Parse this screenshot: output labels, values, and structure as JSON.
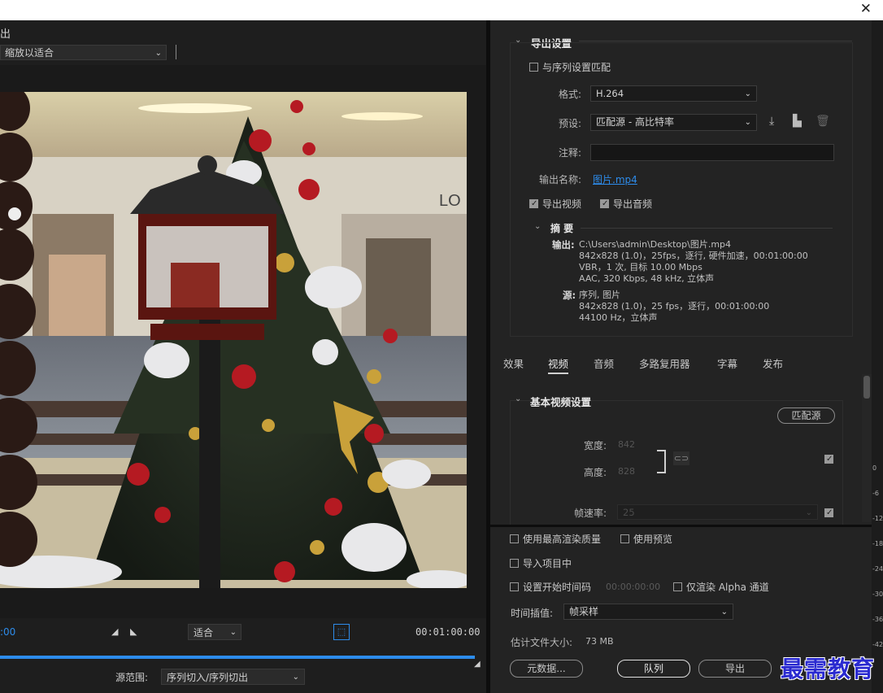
{
  "window": {
    "close_glyph": "✕"
  },
  "left_panel": {
    "tab_title": "出",
    "zoom_value": "缩放以适合",
    "timecode_start": ":00",
    "fit_value": "适合",
    "timecode_end": "00:01:00:00",
    "source_range_label": "源范围:",
    "source_range_value": "序列切入/序列切出"
  },
  "export_settings": {
    "header": "导出设置",
    "match_sequence_label": "与序列设置匹配",
    "match_sequence_checked": false,
    "format_label": "格式:",
    "format_value": "H.264",
    "preset_label": "预设:",
    "preset_value": "匹配源 - 高比特率",
    "comments_label": "注释:",
    "output_name_label": "输出名称:",
    "output_name_value": "图片.mp4",
    "export_video_label": "导出视频",
    "export_video_checked": true,
    "export_audio_label": "导出音频",
    "export_audio_checked": true,
    "summary_header": "摘 要",
    "output_key": "输出:",
    "output_lines": [
      "C:\\Users\\admin\\Desktop\\图片.mp4",
      "842x828 (1.0)，25fps，逐行, 硬件加速，00:01:00:00",
      "VBR，1 次, 目标 10.00 Mbps",
      "AAC, 320 Kbps, 48  kHz, 立体声"
    ],
    "source_key": "源:",
    "source_lines": [
      "序列, 图片",
      "842x828  (1.0)，25 fps，逐行，00:01:00:00",
      "44100 Hz，立体声"
    ]
  },
  "tabs": [
    {
      "label": "效果",
      "active": false
    },
    {
      "label": "视频",
      "active": true
    },
    {
      "label": "音频",
      "active": false
    },
    {
      "label": "多路复用器",
      "active": false
    },
    {
      "label": "字幕",
      "active": false
    },
    {
      "label": "发布",
      "active": false
    }
  ],
  "video_settings": {
    "header": "基本视频设置",
    "match_source_button": "匹配源",
    "width_label": "宽度:",
    "width_value": "842",
    "height_label": "高度:",
    "height_value": "828",
    "frame_rate_label": "帧速率:",
    "frame_rate_value": "25"
  },
  "bottom_options": {
    "max_render_quality": "使用最高渲染质量",
    "use_previews": "使用预览",
    "import_into_project": "导入项目中",
    "set_start_timecode": "设置开始时间码",
    "start_timecode_value": "00:00:00:00",
    "render_alpha_only": "仅渲染 Alpha 通道",
    "time_interpolation_label": "时间插值:",
    "time_interpolation_value": "帧采样",
    "estimated_size_label": "估计文件大小:",
    "estimated_size_value": "73 MB",
    "metadata_button": "元数据...",
    "queue_button": "队列",
    "export_button": "导出"
  },
  "ruler_labels": [
    "0",
    "-6",
    "-12",
    "-18",
    "-24",
    "-30",
    "-36",
    "-42"
  ],
  "watermark": "最需教育",
  "colors": {
    "accent": "#2d8ceb",
    "panel_bg": "#232323"
  }
}
